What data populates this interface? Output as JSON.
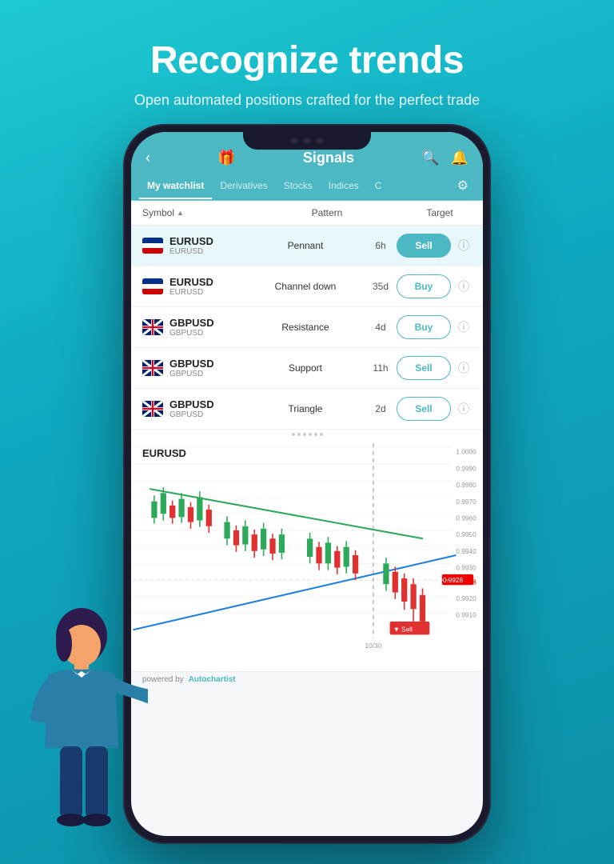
{
  "hero": {
    "title": "Recognize trends",
    "subtitle": "Open automated positions crafted for the perfect trade"
  },
  "app": {
    "header": {
      "title": "Signals",
      "back_label": "←",
      "gift_icon": "🎁",
      "search_icon": "🔍",
      "bell_icon": "🔔"
    },
    "tabs": [
      {
        "label": "My watchlist",
        "active": true
      },
      {
        "label": "Derivatives",
        "active": false
      },
      {
        "label": "Stocks",
        "active": false
      },
      {
        "label": "Indices",
        "active": false
      },
      {
        "label": "C",
        "active": false
      }
    ],
    "columns": {
      "symbol": "Symbol",
      "pattern": "Pattern",
      "target": "Target"
    },
    "signals": [
      {
        "symbol": "EURUSD",
        "sub": "EURUSD",
        "flag": "eu",
        "pattern": "Pennant",
        "time": "6h",
        "action": "Sell",
        "action_type": "sell",
        "filled": true,
        "highlighted": true
      },
      {
        "symbol": "EURUSD",
        "sub": "EURUSD",
        "flag": "eu",
        "pattern": "Channel down",
        "time": "35d",
        "action": "Buy",
        "action_type": "buy",
        "filled": false,
        "highlighted": false
      },
      {
        "symbol": "GBPUSD",
        "sub": "GBPUSD",
        "flag": "gb",
        "pattern": "Resistance",
        "time": "4d",
        "action": "Buy",
        "action_type": "buy",
        "filled": false,
        "highlighted": false
      },
      {
        "symbol": "GBPUSD",
        "sub": "GBPUSD",
        "flag": "gb",
        "pattern": "Support",
        "time": "11h",
        "action": "Sell",
        "action_type": "sell",
        "filled": false,
        "highlighted": false
      },
      {
        "symbol": "GBPUSD",
        "sub": "GBPUSD",
        "flag": "gb",
        "pattern": "Triangle",
        "time": "2d",
        "action": "Sell",
        "action_type": "sell",
        "filled": false,
        "highlighted": false
      }
    ],
    "chart": {
      "symbol": "EURUSD",
      "price_levels": [
        "1.0000",
        "0.9990",
        "0.9980",
        "0.9970",
        "0.9960",
        "0.9950",
        "0.9940",
        "0.9930",
        "0.9928",
        "0.9920",
        "0.9910"
      ],
      "date_label": "10/30",
      "current_price": "0.9928"
    },
    "footer": {
      "powered_by": "powered by",
      "brand": "Autochartist"
    }
  }
}
